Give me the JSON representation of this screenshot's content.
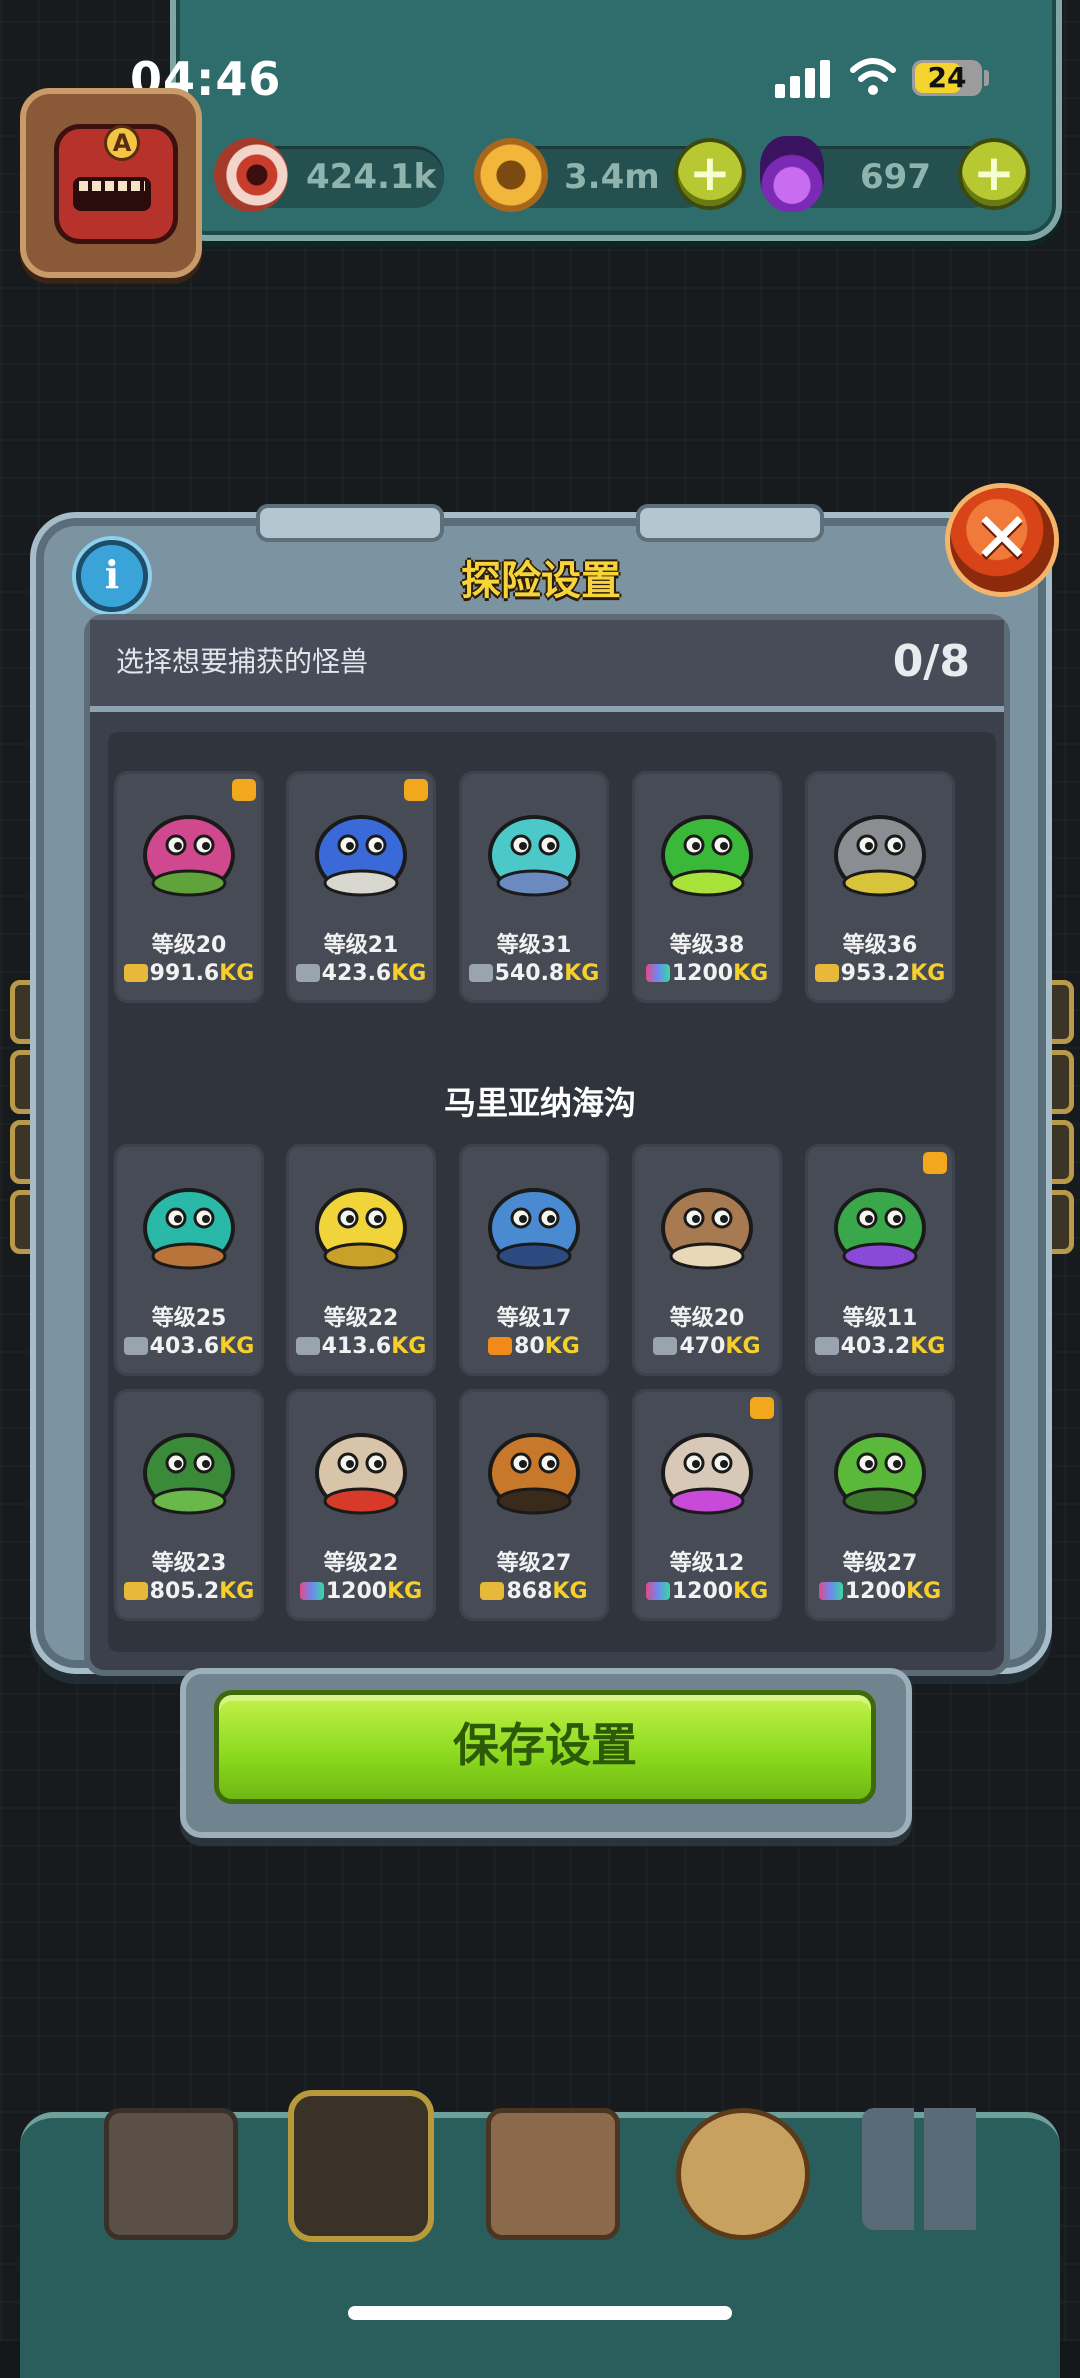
{
  "status": {
    "time": "04:46",
    "battery": "24"
  },
  "hud": {
    "eyeballs": "424.1k",
    "coins": "3.4m",
    "potions": "697"
  },
  "modal": {
    "title": "探险设置",
    "select_prompt": "选择想要捕获的怪兽",
    "selected_count": "0/8",
    "section_title": "马里亚纳海沟",
    "save_label": "保存设置"
  },
  "monsters": [
    {
      "level": "等级20",
      "weight": "991.6",
      "unit": "KG",
      "tag": "gold",
      "crown": true,
      "icon": "pink-plant-monster-icon"
    },
    {
      "level": "等级21",
      "weight": "423.6",
      "unit": "KG",
      "tag": "silver",
      "crown": true,
      "icon": "snail-monster-icon"
    },
    {
      "level": "等级31",
      "weight": "540.8",
      "unit": "KG",
      "tag": "silver",
      "crown": false,
      "icon": "fish-monster-icon"
    },
    {
      "level": "等级38",
      "weight": "1200",
      "unit": "KG",
      "tag": "rainbow",
      "crown": false,
      "icon": "caterpillar-monster-icon"
    },
    {
      "level": "等级36",
      "weight": "953.2",
      "unit": "KG",
      "tag": "gold",
      "crown": false,
      "icon": "rock-monster-icon"
    },
    {
      "level": "等级25",
      "weight": "403.6",
      "unit": "KG",
      "tag": "silver",
      "crown": false,
      "icon": "anemone-monster-icon"
    },
    {
      "level": "等级22",
      "weight": "413.6",
      "unit": "KG",
      "tag": "silver",
      "crown": false,
      "icon": "banana-squid-monster-icon"
    },
    {
      "level": "等级17",
      "weight": "80",
      "unit": "KG",
      "tag": "orange",
      "crown": false,
      "icon": "crab-monster-icon"
    },
    {
      "level": "等级20",
      "weight": "470",
      "unit": "KG",
      "tag": "silver",
      "crown": false,
      "icon": "walrus-monster-icon"
    },
    {
      "level": "等级11",
      "weight": "403.2",
      "unit": "KG",
      "tag": "silver",
      "crown": true,
      "icon": "mantis-monster-icon"
    },
    {
      "level": "等级23",
      "weight": "805.2",
      "unit": "KG",
      "tag": "gold",
      "crown": false,
      "icon": "sea-cucumber-monster-icon"
    },
    {
      "level": "等级22",
      "weight": "1200",
      "unit": "KG",
      "tag": "rainbow",
      "crown": false,
      "icon": "clam-monster-icon"
    },
    {
      "level": "等级27",
      "weight": "868",
      "unit": "KG",
      "tag": "gold",
      "crown": false,
      "icon": "tiger-shrimp-monster-icon"
    },
    {
      "level": "等级12",
      "weight": "1200",
      "unit": "KG",
      "tag": "rainbow",
      "crown": true,
      "icon": "jellyfish-shell-monster-icon"
    },
    {
      "level": "等级27",
      "weight": "1200",
      "unit": "KG",
      "tag": "rainbow",
      "crown": false,
      "icon": "seahorse-monster-icon"
    }
  ],
  "bottom_tabs": [
    "shop-icon",
    "portal-icon",
    "book-icon",
    "money-bag-icon",
    "collection-grid-icon"
  ]
}
